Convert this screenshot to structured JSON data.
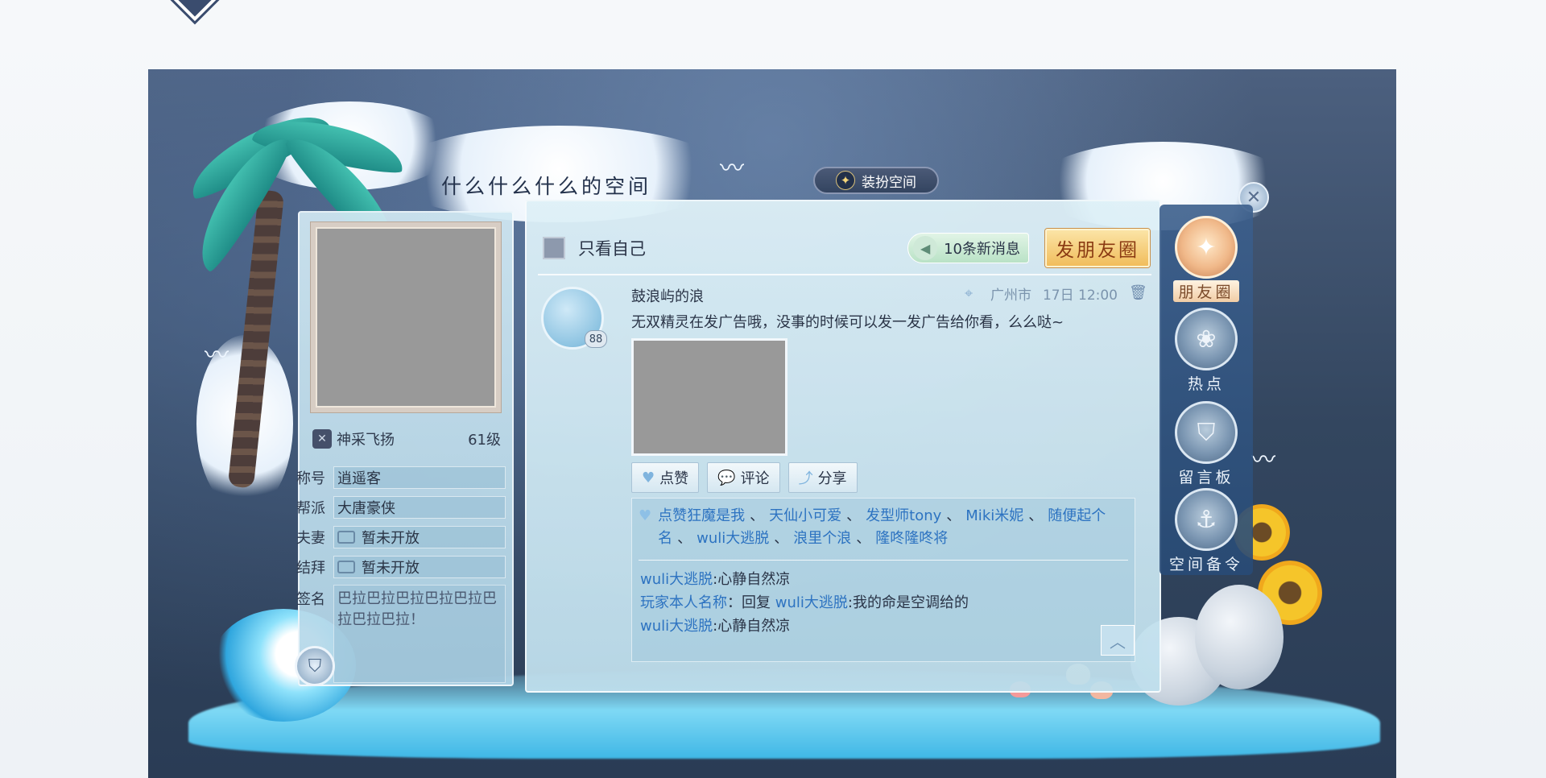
{
  "space": {
    "title": "什么什么什么的空间",
    "dress_button": "装扮空间",
    "dress_icon": "✦",
    "close_icon": "✕"
  },
  "profile": {
    "name": "神采飞扬",
    "level": "61级",
    "rows": [
      {
        "label": "称号",
        "value": "逍遥客"
      },
      {
        "label": "帮派",
        "value": "大唐豪侠"
      },
      {
        "label": "夫妻",
        "value": "暂未开放"
      },
      {
        "label": "结拜",
        "value": "暂未开放"
      }
    ],
    "signature_label": "签名",
    "signature": "巴拉巴拉巴拉巴拉巴拉巴拉巴拉巴拉！"
  },
  "toolbar": {
    "only_me": "只看自己",
    "new_messages": "10条新消息",
    "post_button": "发朋友圈"
  },
  "post": {
    "author": "鼓浪屿的浪",
    "avatar_badge": "88",
    "location": "广州市",
    "time": "17日 12:00",
    "content": "无双精灵在发广告哦，没事的时候可以发一发广告给你看，么么哒~",
    "actions": [
      {
        "icon": "heart-icon",
        "glyph": "♥",
        "label": "点赞"
      },
      {
        "icon": "comment-icon",
        "glyph": "💬",
        "label": "评论"
      },
      {
        "icon": "share-icon",
        "glyph": "⤴",
        "label": "分享"
      }
    ],
    "likes": [
      "点赞狂魔是我",
      "天仙小可爱",
      "发型师tony",
      "Miki米妮",
      "随便起个名",
      "wuli大逃脱",
      "浪里个浪",
      "隆咚隆咚将"
    ],
    "comments": [
      {
        "user": "wuli大逃脱",
        "reply_prefix": "",
        "reply_to": "",
        "text": ":心静自然凉"
      },
      {
        "user": "玩家本人名称",
        "reply_prefix": "：回复 ",
        "reply_to": "wuli大逃脱",
        "text": ":我的命是空调给的"
      },
      {
        "user": "wuli大逃脱",
        "reply_prefix": "",
        "reply_to": "",
        "text": ":心静自然凉"
      }
    ]
  },
  "nav": [
    {
      "label": "朋友圈",
      "icon": "star-icon",
      "glyph": "✦",
      "active": true
    },
    {
      "label": "热点",
      "icon": "lotus-icon",
      "glyph": "❀",
      "active": false
    },
    {
      "label": "留言板",
      "icon": "shield-icon",
      "glyph": "⛉",
      "active": false
    },
    {
      "label": "空间备令",
      "icon": "anchor-icon",
      "glyph": "⚓",
      "active": false
    }
  ]
}
